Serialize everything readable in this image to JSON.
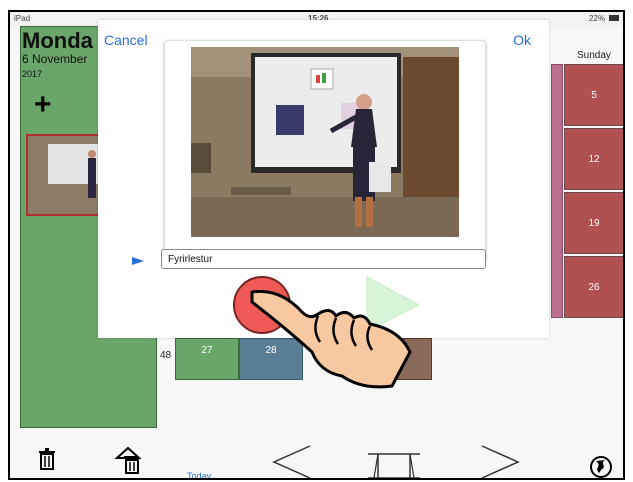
{
  "status": {
    "device": "iPad",
    "time": "15:26",
    "battery": "22%"
  },
  "day": {
    "title": "Monda",
    "date": "6 November",
    "year": "2017"
  },
  "calendar": {
    "sunday_label": "Sunday",
    "sunday_dates": [
      "5",
      "12",
      "19",
      "26"
    ],
    "week_number": "48",
    "bottom_dates": [
      "27",
      "28"
    ],
    "today_label": "Today"
  },
  "dialog": {
    "cancel_label": "Cancel",
    "ok_label": "Ok",
    "name_value": "Fyrirlestur"
  },
  "icons": {
    "add": "plus-icon",
    "trash": "trash-icon",
    "trash_day": "trash-day-icon",
    "prev": "chevron-left-icon",
    "next": "chevron-right-icon",
    "overview": "overview-icon",
    "globe": "globe-icon",
    "record": "record-icon",
    "play": "play-icon"
  },
  "colors": {
    "sidebar": "#6aa56a",
    "sunday": "#b05050",
    "accent": "#2a6fd6",
    "record": "#ef5a56"
  }
}
